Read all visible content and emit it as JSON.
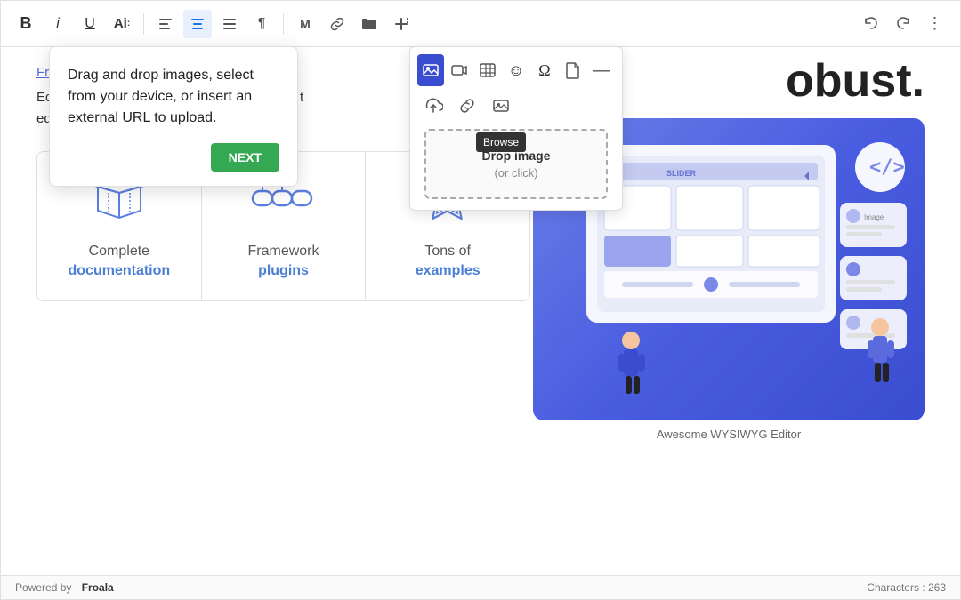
{
  "toolbar": {
    "buttons": [
      {
        "name": "bold",
        "label": "B",
        "style": "font-weight:700"
      },
      {
        "name": "italic",
        "label": "I",
        "style": "font-style:italic"
      },
      {
        "name": "underline",
        "label": "U",
        "style": "text-decoration:underline"
      },
      {
        "name": "font-size",
        "label": "A​̲"
      },
      {
        "name": "align-left",
        "label": "≡"
      },
      {
        "name": "align-center",
        "label": "≡",
        "active": true
      },
      {
        "name": "list",
        "label": "☰"
      },
      {
        "name": "paragraph",
        "label": "¶"
      },
      {
        "name": "media",
        "label": "M"
      },
      {
        "name": "link",
        "label": "🔗"
      },
      {
        "name": "folder",
        "label": "📁"
      },
      {
        "name": "insert-plus",
        "label": "+"
      }
    ],
    "right_buttons": [
      {
        "name": "undo",
        "label": "↩"
      },
      {
        "name": "redo",
        "label": "↪"
      },
      {
        "name": "more",
        "label": "⋮"
      }
    ]
  },
  "insert_popup": {
    "row1": [
      {
        "name": "image",
        "icon": "🖼",
        "active": true
      },
      {
        "name": "video",
        "icon": "🎥"
      },
      {
        "name": "table",
        "icon": "⊞"
      },
      {
        "name": "emoji",
        "icon": "☺"
      },
      {
        "name": "special-char",
        "icon": "Ω"
      },
      {
        "name": "file",
        "icon": "📄"
      },
      {
        "name": "hr",
        "icon": "—"
      }
    ],
    "row2": [
      {
        "name": "upload-cloud",
        "icon": "☁"
      },
      {
        "name": "link-insert",
        "icon": "🔗"
      },
      {
        "name": "browse",
        "icon": "🖼"
      }
    ],
    "browse_tooltip": "Browse"
  },
  "drop_zone": {
    "title": "Drop image",
    "subtitle": "(or click)"
  },
  "tooltip": {
    "text": "Drag and drop images, select from your device, or insert an external URL to upload.",
    "next_label": "NEXT"
  },
  "content": {
    "heading_partial": "obust.",
    "editor_name": "Froala Editor",
    "editor_desc_1": "Editor written in JavaScript that enables rich t",
    "editor_desc_2": "editing capabilities for your applications.",
    "features": [
      {
        "icon": "📚",
        "label": "Complete",
        "link_text": "documentation"
      },
      {
        "icon": "🔧",
        "label": "Framework",
        "link_text": "plugins"
      },
      {
        "icon": "💎",
        "label": "Tons of",
        "link_text": "examples"
      }
    ],
    "illustration_caption": "Awesome WYSIWYG Editor"
  },
  "footer": {
    "powered_by": "Powered by",
    "brand": "Froala",
    "characters_label": "Characters : 263"
  },
  "ai_badge": "Ai"
}
